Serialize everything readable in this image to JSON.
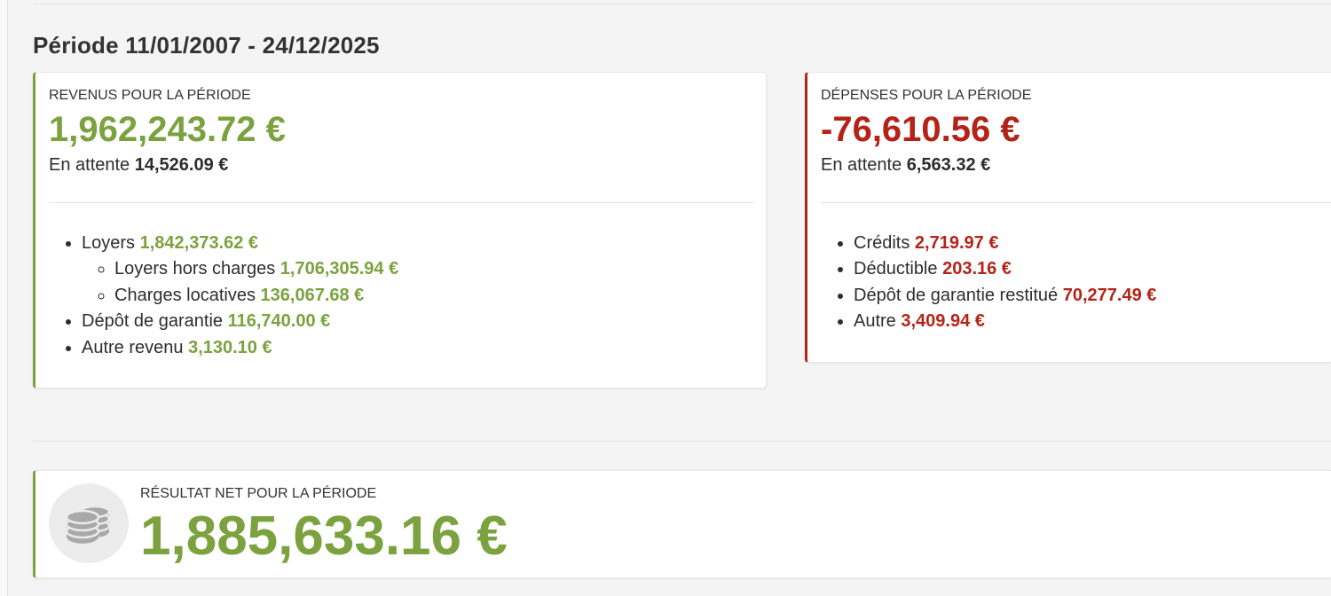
{
  "period": {
    "title": "Période 11/01/2007 - 24/12/2025"
  },
  "colors": {
    "positive": "#7ba23f",
    "negative": "#b42318",
    "icon_bg": "#ececec",
    "icon_fg": "#a9a9a9"
  },
  "revenue": {
    "label": "REVENUS POUR LA PÉRIODE",
    "amount": "1,962,243.72 €",
    "pending_label": "En attente",
    "pending_value": "14,526.09 €",
    "items": [
      {
        "label": "Loyers",
        "value": "1,842,373.62 €",
        "sub": [
          {
            "label": "Loyers hors charges",
            "value": "1,706,305.94 €"
          },
          {
            "label": "Charges locatives",
            "value": "136,067.68 €"
          }
        ]
      },
      {
        "label": "Dépôt de garantie",
        "value": "116,740.00 €"
      },
      {
        "label": "Autre revenu",
        "value": "3,130.10 €"
      }
    ]
  },
  "expenses": {
    "label": "DÉPENSES POUR LA PÉRIODE",
    "amount": "-76,610.56 €",
    "pending_label": "En attente",
    "pending_value": "6,563.32 €",
    "items": [
      {
        "label": "Crédits",
        "value": "2,719.97 €"
      },
      {
        "label": "Déductible",
        "value": "203.16 €"
      },
      {
        "label": "Dépôt de garantie restitué",
        "value": "70,277.49 €"
      },
      {
        "label": "Autre",
        "value": "3,409.94 €"
      }
    ]
  },
  "net": {
    "label": "RÉSULTAT NET POUR LA PÉRIODE",
    "amount": "1,885,633.16 €",
    "icon": "coins-icon"
  }
}
